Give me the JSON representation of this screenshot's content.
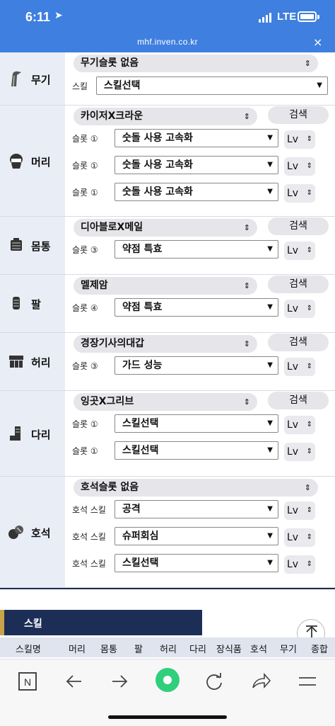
{
  "status": {
    "time": "6:11",
    "network": "LTE"
  },
  "browser": {
    "url": "mhf.inven.co.kr",
    "close": "×"
  },
  "equipment": {
    "search_label": "검색",
    "lv_label": "Lv",
    "rows": [
      {
        "name": "무기",
        "icon": "weapon-icon",
        "header": "무기슬롯 없음",
        "has_search": false,
        "slots": [
          {
            "label": "스킬",
            "value": "스킬선택",
            "lv": false
          }
        ]
      },
      {
        "name": "머리",
        "icon": "helmet-icon",
        "header": "카이저X크라운",
        "has_search": true,
        "slots": [
          {
            "label": "슬롯 ①",
            "value": "숫돌 사용 고속화",
            "lv": true
          },
          {
            "label": "슬롯 ①",
            "value": "숫돌 사용 고속화",
            "lv": true
          },
          {
            "label": "슬롯 ①",
            "value": "숫돌 사용 고속화",
            "lv": true
          }
        ]
      },
      {
        "name": "몸통",
        "icon": "body-armor-icon",
        "header": "디아블로X메일",
        "has_search": true,
        "slots": [
          {
            "label": "슬롯 ③",
            "value": "약점 특효",
            "lv": true
          }
        ]
      },
      {
        "name": "팔",
        "icon": "arm-armor-icon",
        "header": "멜제암",
        "has_search": true,
        "slots": [
          {
            "label": "슬롯 ④",
            "value": "약점 특효",
            "lv": true
          }
        ]
      },
      {
        "name": "허리",
        "icon": "waist-armor-icon",
        "header": "경장기사의대갑",
        "has_search": true,
        "slots": [
          {
            "label": "슬롯 ③",
            "value": "가드 성능",
            "lv": true
          }
        ]
      },
      {
        "name": "다리",
        "icon": "leg-armor-icon",
        "header": "잉곳X그리브",
        "has_search": true,
        "slots": [
          {
            "label": "슬롯 ①",
            "value": "스킬선택",
            "lv": true
          },
          {
            "label": "슬롯 ①",
            "value": "스킬선택",
            "lv": true
          }
        ]
      },
      {
        "name": "호석",
        "icon": "gem-icon",
        "header": "호석슬롯 없음",
        "has_search": false,
        "slots": [
          {
            "label": "호석 스킬",
            "value": "공격",
            "lv": true
          },
          {
            "label": "호석 스킬",
            "value": "슈퍼회심",
            "lv": true
          },
          {
            "label": "호석 스킬",
            "value": "스킬선택",
            "lv": true
          }
        ]
      }
    ]
  },
  "skill_section": {
    "tab_label": "스킬",
    "columns": [
      "스킬명",
      "머리",
      "몸통",
      "팔",
      "허리",
      "다리",
      "장식품",
      "호석",
      "무기",
      "종합"
    ]
  },
  "navbar": {
    "buttons": [
      "naver-home-icon",
      "back-arrow-icon",
      "forward-arrow-icon",
      "green-circle-icon",
      "refresh-icon",
      "share-icon",
      "menu-icon"
    ],
    "home_label": "N"
  },
  "colors": {
    "header_blue": "#3e7fe0",
    "navy": "#1c2e55",
    "accent_gold": "#c9a34a",
    "green": "#2fcf7c"
  }
}
